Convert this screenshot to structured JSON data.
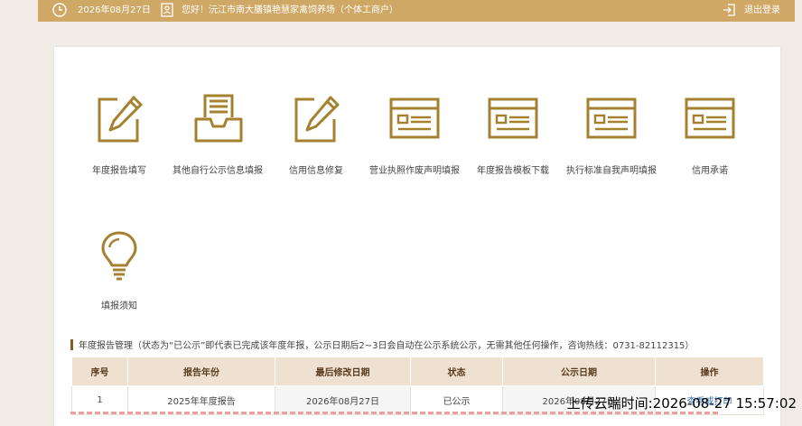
{
  "topbar": {
    "date": "2026年08月27日",
    "greeting": "您好！沅江市南大膳镇艳慧家禽饲养场（个体工商户）",
    "logout": "退出登录",
    "clock_icon": "clock-icon",
    "user_icon": "user-card-icon",
    "logout_icon": "logout-icon"
  },
  "functions": [
    {
      "label": "年度报告填写",
      "icon": "edit-pencil-icon"
    },
    {
      "label": "其他自行公示信息填报",
      "icon": "inbox-tray-icon"
    },
    {
      "label": "信用信息修复",
      "icon": "edit-pencil-icon"
    },
    {
      "label": "营业执照作废声明填报",
      "icon": "document-form-icon"
    },
    {
      "label": "年度报告模板下载",
      "icon": "document-form-icon"
    },
    {
      "label": "执行标准自我声明填报",
      "icon": "document-form-icon"
    },
    {
      "label": "信用承诺",
      "icon": "document-form-icon"
    },
    {
      "label": "填报须知",
      "icon": "lightbulb-icon"
    }
  ],
  "section": {
    "title": "年度报告管理（状态为“已公示”即代表已完成该年度年报，公示日期后2~3日会自动在公示系统公示，无需其他任何操作，咨询热线：0731-82112315）"
  },
  "table": {
    "headers": [
      "序号",
      "报告年份",
      "最后修改日期",
      "状态",
      "公示日期",
      "操作"
    ],
    "rows": [
      {
        "no": "1",
        "year": "2025年年度报告",
        "modified": "2026年08月27日",
        "status": "已公示",
        "pub_date": "2026年08月27日",
        "action": "查看或打印"
      }
    ]
  },
  "overlay": {
    "timestamp": "上传云端时间:2026-08-27 15:57:02"
  },
  "colors": {
    "gold": "#cfa865",
    "icon_gold": "#a5812f",
    "header_bg": "#eee1d0",
    "link": "#3b6fb6"
  }
}
